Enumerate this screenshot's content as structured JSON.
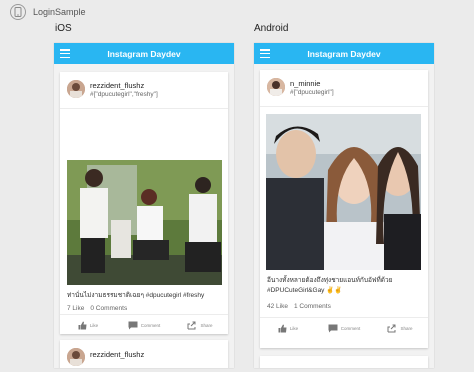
{
  "app": {
    "title": "LoginSample"
  },
  "platforms": [
    {
      "label": "iOS",
      "topbar_title": "Instagram Daydev",
      "posts": [
        {
          "username": "rezzident_flushz",
          "tags": "#[\"dpucutegirl\",\"freshy\"]",
          "caption": "ท่านั่นไม่งามธรรมชาติเฉยๆ #dpucutegirl #freshy",
          "likes": "7 Like",
          "comments": "0 Comments"
        },
        {
          "username": "rezzident_flushz"
        }
      ]
    },
    {
      "label": "Android",
      "topbar_title": "Instagram Daydev",
      "posts": [
        {
          "username": "n_minnie",
          "tags": "#[\"dpucutegirl\"]",
          "caption": "อีนางทั้งหลายต้องถึงทุ่งชายแอนท์กับอัฟที่ด้วย #DPUCuteGirl&Gay ✌️✌️",
          "likes": "42 Like",
          "comments": "1 Comments"
        }
      ]
    }
  ],
  "actions": {
    "like": "Like",
    "comment": "Comment",
    "share": "Share"
  },
  "icons": {
    "app_logo": "phone-icon",
    "menu": "hamburger-icon",
    "like": "thumbs-up-icon",
    "comment": "comment-bubble-icon",
    "share": "share-arrow-icon"
  },
  "colors": {
    "topbar": "#29b6f2",
    "background": "#ebebeb"
  }
}
